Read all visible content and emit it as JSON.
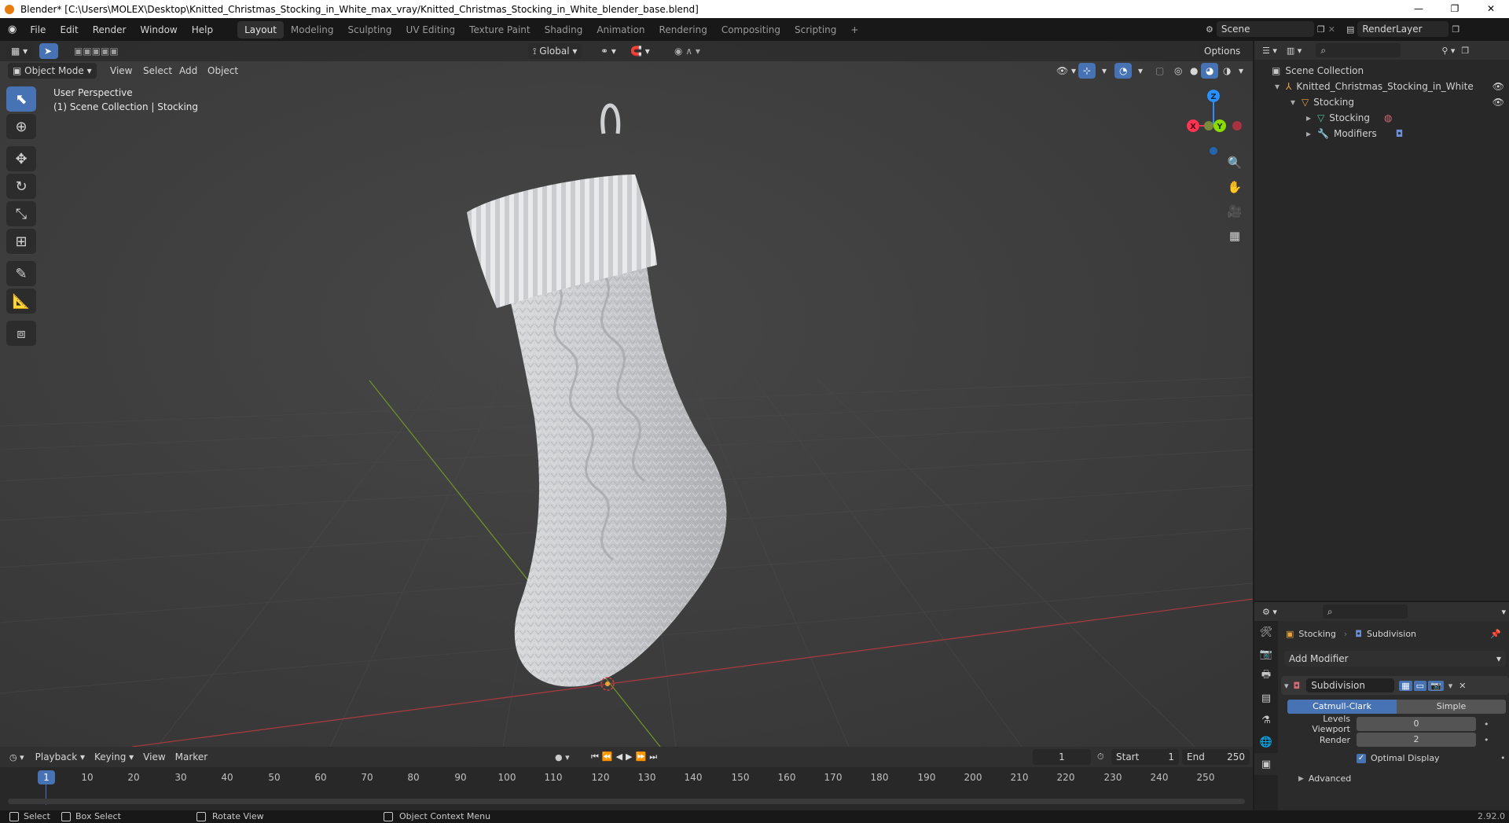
{
  "titlebar": {
    "title": "Blender* [C:\\Users\\MOLEX\\Desktop\\Knitted_Christmas_Stocking_in_White_max_vray/Knitted_Christmas_Stocking_in_White_blender_base.blend]",
    "minimize": "—",
    "restore": "❐",
    "close": "✕"
  },
  "menu": [
    "File",
    "Edit",
    "Render",
    "Window",
    "Help"
  ],
  "workspaces": [
    "Layout",
    "Modeling",
    "Sculpting",
    "UV Editing",
    "Texture Paint",
    "Shading",
    "Animation",
    "Rendering",
    "Compositing",
    "Scripting"
  ],
  "workspace_add": "+",
  "scene": {
    "name": "Scene",
    "render_layer": "RenderLayer"
  },
  "viewport": {
    "mode": "Object Mode",
    "menus": [
      "View",
      "Select",
      "Add",
      "Object"
    ],
    "transform_orientation": "Global",
    "options": "Options",
    "perspective_label": "User Perspective",
    "collection_label": "(1) Scene Collection | Stocking",
    "gizmo": {
      "x": "X",
      "y": "Y",
      "z": "Z"
    }
  },
  "outliner": {
    "items": [
      {
        "label": "Scene Collection",
        "icon": "collection-icon"
      },
      {
        "label": "Knitted_Christmas_Stocking_in_White",
        "icon": "empty-icon"
      },
      {
        "label": "Stocking",
        "icon": "object-icon"
      },
      {
        "label": "Stocking",
        "icon": "mesh-icon"
      },
      {
        "label": "Modifiers",
        "icon": "wrench-icon"
      }
    ]
  },
  "properties": {
    "object_name": "Stocking",
    "modifier_crumb": "Subdivision",
    "add_modifier": "Add Modifier",
    "modifier_name": "Subdivision",
    "algorithm_options": [
      "Catmull-Clark",
      "Simple"
    ],
    "levels_viewport_label": "Levels Viewport",
    "levels_viewport_value": "0",
    "render_label": "Render",
    "render_value": "2",
    "optimal_display_label": "Optimal Display",
    "optimal_display_checked": true,
    "advanced_label": "Advanced"
  },
  "timeline": {
    "menus": [
      "Playback",
      "Keying",
      "View",
      "Marker"
    ],
    "current_frame": "1",
    "start_label": "Start",
    "start_value": "1",
    "end_label": "End",
    "end_value": "250",
    "ticks": [
      "1",
      "10",
      "20",
      "30",
      "40",
      "50",
      "60",
      "70",
      "80",
      "90",
      "100",
      "110",
      "120",
      "130",
      "140",
      "150",
      "160",
      "170",
      "180",
      "190",
      "200",
      "210",
      "220",
      "230",
      "240",
      "250"
    ]
  },
  "statusbar": {
    "select": "Select",
    "box_select": "Box Select",
    "rotate_view": "Rotate View",
    "context_menu": "Object Context Menu",
    "version": "2.92.0"
  },
  "colors": {
    "accent": "#4772b3",
    "x_axis": "#ff3352",
    "y_axis": "#8bdc00",
    "z_axis": "#2890ff",
    "viewport_bg": "#3d3d3d"
  }
}
